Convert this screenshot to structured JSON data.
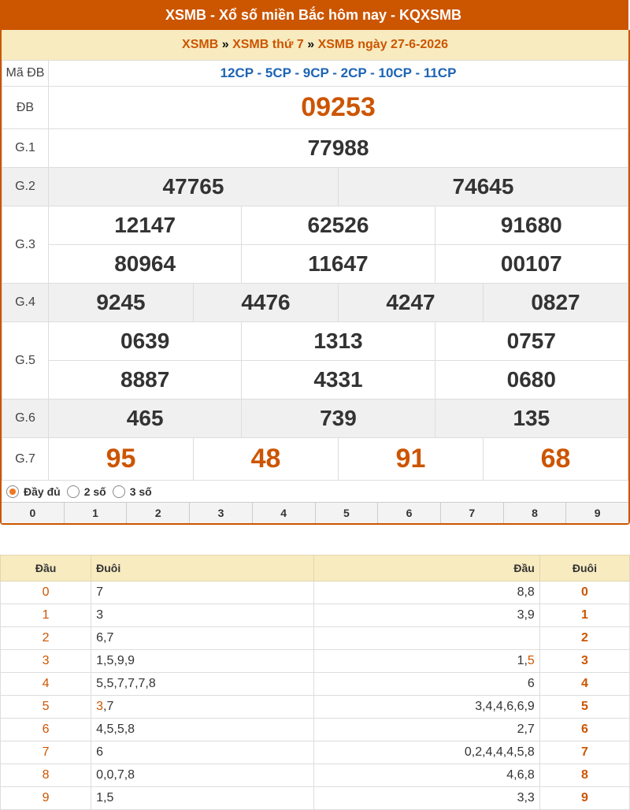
{
  "header": {
    "title": "XSMB - Xổ số miền Bắc hôm nay - KQXSMB"
  },
  "breadcrumb": {
    "link1": "XSMB",
    "sep": "»",
    "link2": "XSMB thứ 7",
    "link3": "XSMB ngày 27-6-2026"
  },
  "madb": {
    "label": "Mã ĐB",
    "value": "12CP - 5CP - 9CP - 2CP - 10CP - 11CP"
  },
  "prizes": {
    "db": {
      "label": "ĐB",
      "value": "09253"
    },
    "g1": {
      "label": "G.1",
      "values": [
        "77988"
      ]
    },
    "g2": {
      "label": "G.2",
      "values": [
        "47765",
        "74645"
      ]
    },
    "g3": {
      "label": "G.3",
      "values": [
        "12147",
        "62526",
        "91680",
        "80964",
        "11647",
        "00107"
      ]
    },
    "g4": {
      "label": "G.4",
      "values": [
        "9245",
        "4476",
        "4247",
        "0827"
      ]
    },
    "g5": {
      "label": "G.5",
      "values": [
        "0639",
        "1313",
        "0757",
        "8887",
        "4331",
        "0680"
      ]
    },
    "g6": {
      "label": "G.6",
      "values": [
        "465",
        "739",
        "135"
      ]
    },
    "g7": {
      "label": "G.7",
      "values": [
        "95",
        "48",
        "91",
        "68"
      ]
    }
  },
  "options": {
    "full": "Đầy đủ",
    "two": "2 số",
    "three": "3 số",
    "selected": "full"
  },
  "digits": [
    "0",
    "1",
    "2",
    "3",
    "4",
    "5",
    "6",
    "7",
    "8",
    "9"
  ],
  "loto": {
    "headers": {
      "dau": "Đầu",
      "duoi": "Đuôi"
    },
    "rows": [
      {
        "dau": "0",
        "duoi": "7",
        "dau_right": "8,8",
        "duoi_right": "0"
      },
      {
        "dau": "1",
        "duoi": "3",
        "dau_right": "3,9",
        "duoi_right": "1"
      },
      {
        "dau": "2",
        "duoi": "6,7",
        "dau_right": "",
        "duoi_right": "2"
      },
      {
        "dau": "3",
        "duoi": "1,5,9,9",
        "dau_right": "1,5",
        "dau_right_hl": "5",
        "duoi_right": "3"
      },
      {
        "dau": "4",
        "duoi": "5,5,7,7,7,8",
        "dau_right": "6",
        "duoi_right": "4"
      },
      {
        "dau": "5",
        "duoi": "3,7",
        "duoi_hl": "3",
        "dau_right": "3,4,4,6,6,9",
        "duoi_right": "5"
      },
      {
        "dau": "6",
        "duoi": "4,5,5,8",
        "dau_right": "2,7",
        "duoi_right": "6"
      },
      {
        "dau": "7",
        "duoi": "6",
        "dau_right": "0,2,4,4,4,5,8",
        "duoi_right": "7"
      },
      {
        "dau": "8",
        "duoi": "0,0,7,8",
        "dau_right": "4,6,8",
        "duoi_right": "8"
      },
      {
        "dau": "9",
        "duoi": "1,5",
        "dau_right": "3,3",
        "duoi_right": "9"
      }
    ]
  },
  "colors": {
    "brand": "#cc5500",
    "accent_blue": "#1d64b4",
    "crumb_bg": "#f8ebc0"
  }
}
